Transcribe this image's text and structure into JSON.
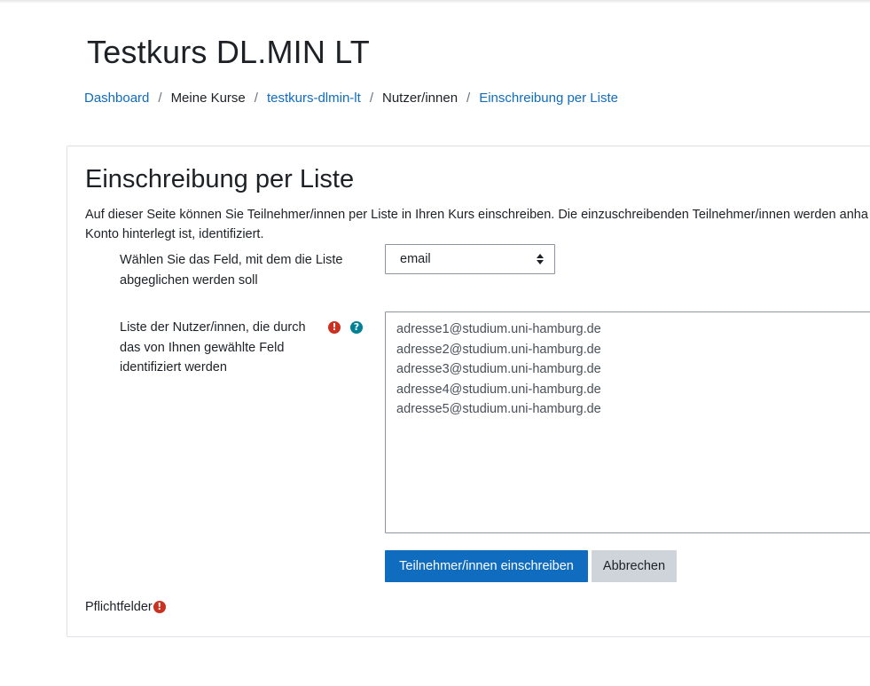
{
  "page": {
    "title": "Testkurs DL.MIN LT"
  },
  "breadcrumb": {
    "items": [
      {
        "label": "Dashboard",
        "link": true
      },
      {
        "label": "Meine Kurse",
        "link": false
      },
      {
        "label": "testkurs-dlmin-lt",
        "link": true
      },
      {
        "label": "Nutzer/innen",
        "link": false
      },
      {
        "label": "Einschreibung per Liste",
        "link": true
      }
    ],
    "separator": "/"
  },
  "form": {
    "heading": "Einschreibung per Liste",
    "description_line1": "Auf dieser Seite können Sie Teilnehmer/innen per Liste in Ihren Kurs einschreiben. Die einzuschreibenden Teilnehmer/innen werden anha",
    "description_line2": "Konto hinterlegt ist, identifiziert.",
    "field_label_line1": "Wählen Sie das Feld, mit dem die Liste",
    "field_label_line2": "abgeglichen werden soll",
    "field_value": "email",
    "list_label_line1": "Liste der Nutzer/innen, die durch",
    "list_label_line2": "das von Ihnen gewählte Feld",
    "list_label_line3": "identifiziert werden",
    "list_entries": [
      "adresse1@studium.uni-hamburg.de",
      "adresse2@studium.uni-hamburg.de",
      "adresse3@studium.uni-hamburg.de",
      "adresse4@studium.uni-hamburg.de",
      "adresse5@studium.uni-hamburg.de"
    ],
    "submit_label": "Teilnehmer/innen einschreiben",
    "cancel_label": "Abbrechen",
    "required_note": "Pflichtfelder"
  },
  "icons": {
    "required": "exclamation-circle-icon",
    "help": "question-circle-icon",
    "required_glyph": "!",
    "help_glyph": "?"
  },
  "colors": {
    "link": "#0f6cbf",
    "primary_button": "#0f6cbf",
    "secondary_button": "#ced4da",
    "required_icon": "#ca3120",
    "help_icon": "#008196"
  }
}
